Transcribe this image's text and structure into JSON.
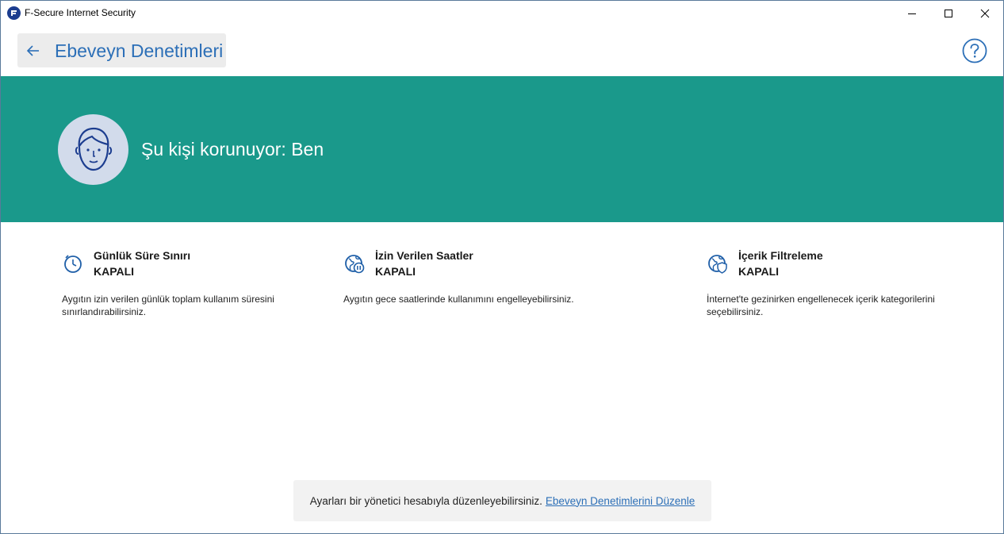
{
  "window": {
    "title": "F-Secure Internet Security",
    "controls": {
      "minimize": "minimize-icon",
      "maximize": "maximize-icon",
      "close": "close-icon"
    }
  },
  "header": {
    "back_icon": "arrow-left-icon",
    "title": "Ebeveyn Denetimleri",
    "help_icon": "help-circle-icon"
  },
  "banner": {
    "background": "#1a998b",
    "avatar_icon": "user-face-icon",
    "protected_text": "Şu kişi korunuyor: Ben"
  },
  "features": [
    {
      "icon": "clock-icon",
      "name": "Günlük Süre Sınırı",
      "status": "KAPALI",
      "description": "Aygıtın izin verilen günlük toplam kullanım süresini sınırlandırabilirsiniz."
    },
    {
      "icon": "globe-pause-icon",
      "name": "İzin Verilen Saatler",
      "status": "KAPALI",
      "description": "Aygıtın gece saatlerinde kullanımını engelleyebilirsiniz."
    },
    {
      "icon": "globe-shield-icon",
      "name": "İçerik Filtreleme",
      "status": "KAPALI",
      "description": "İnternet'te gezinirken engellenecek içerik kategorilerini seçebilirsiniz."
    }
  ],
  "footer": {
    "text": "Ayarları bir yönetici hesabıyla düzenleyebilirsiniz.",
    "link": "Ebeveyn Denetimlerini Düzenle"
  },
  "colors": {
    "accent_blue": "#2c6fb7",
    "teal": "#1a998b",
    "icon_blue": "#1f5fa8"
  }
}
